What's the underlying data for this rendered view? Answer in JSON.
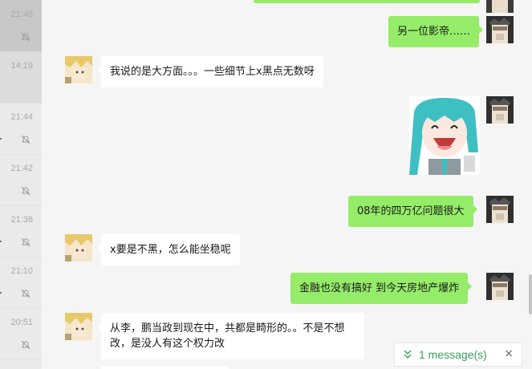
{
  "conversations": [
    {
      "time": "21:45",
      "muted": true
    },
    {
      "time": "14:19",
      "muted": false
    },
    {
      "time": "21:44",
      "muted": true
    },
    {
      "time": "21:42",
      "muted": true
    },
    {
      "time": "21:38",
      "muted": true
    },
    {
      "time": "21:10",
      "muted": true
    },
    {
      "time": "20:51",
      "muted": true
    }
  ],
  "messages": [
    {
      "side": "out",
      "text": "另一位影帝……"
    },
    {
      "side": "in",
      "text": "我说的是大方面。。。一些细节上x黑点无数呀"
    },
    {
      "side": "out",
      "type": "sticker",
      "sticker": "miku-laughing-sticker"
    },
    {
      "side": "out",
      "text": "08年的四万亿问题很大"
    },
    {
      "side": "in",
      "text": "x要是不黑，怎么能坐稳呢"
    },
    {
      "side": "out",
      "text": "金融也没有搞好 到今天房地产爆炸"
    },
    {
      "side": "in",
      "text": "从李，鹏当政到现在中，共都是畸形的。。不是不想改，是没人有这个权力改"
    }
  ],
  "new_message_bar": {
    "label": "1 message(s)",
    "close_label": "×"
  },
  "colors": {
    "out_bubble": "#95ec69",
    "in_bubble": "#ffffff",
    "accent": "#3a9d5b"
  }
}
